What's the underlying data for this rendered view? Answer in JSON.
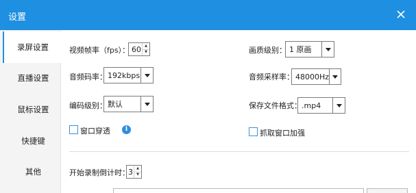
{
  "window": {
    "title": "设置",
    "close_icon": "close-icon"
  },
  "sidebar": {
    "items": [
      {
        "label": "录屏设置"
      },
      {
        "label": "直播设置"
      },
      {
        "label": "鼠标设置"
      },
      {
        "label": "快捷键"
      },
      {
        "label": "其他"
      }
    ]
  },
  "settings": {
    "fps": {
      "label": "视频帧率（fps）：",
      "value": "60"
    },
    "quality": {
      "label": "画质级别：",
      "value": "1 原画"
    },
    "audio_bitrate": {
      "label": "音频码率：",
      "value": "192kbps"
    },
    "sample_rate": {
      "label": "音频采样率：",
      "value": "48000Hz"
    },
    "encoder_level": {
      "label": "编码级别：",
      "value": "默认"
    },
    "file_format": {
      "label": "保存文件格式：",
      "value": ".mp4"
    },
    "window_passthrough": {
      "label": "窗口穿透"
    },
    "capture_enhance": {
      "label": "抓取窗口加强"
    },
    "countdown": {
      "label": "开始录制倒计时：",
      "value": "3"
    }
  },
  "colors": {
    "accent": "#1e8fe1",
    "sidebar_bg": "#f4f4f4"
  }
}
